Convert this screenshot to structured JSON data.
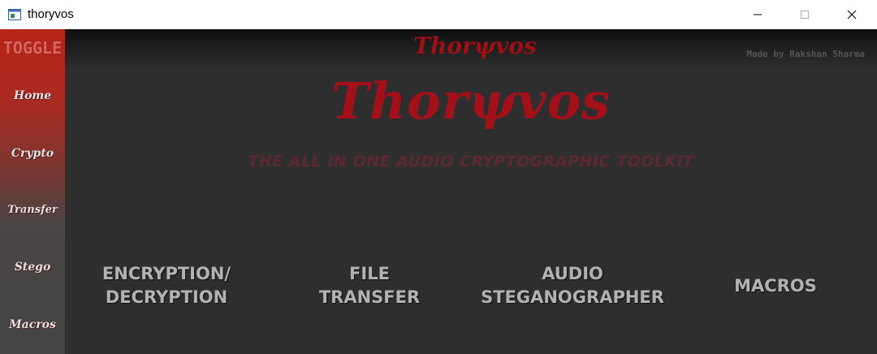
{
  "window": {
    "title": "thoryvos"
  },
  "sidebar": {
    "toggle_label": "TOGGLE",
    "items": [
      {
        "label": "Home"
      },
      {
        "label": "Crypto"
      },
      {
        "label": "Transfer"
      },
      {
        "label": "Stego"
      },
      {
        "label": "Macros"
      }
    ]
  },
  "header": {
    "logo": "Thorψvos",
    "credit": "Made by Rakshan Sharma"
  },
  "hero": {
    "title": "Thorψvos",
    "subtitle": "THE ALL IN ONE AUDIO CRYPTOGRAPHIC TOOLKIT"
  },
  "tools": [
    {
      "label": "ENCRYPTION/\nDECRYPTION"
    },
    {
      "label": "FILE\nTRANSFER"
    },
    {
      "label": "AUDIO\nSTEGANOGRAPHER"
    },
    {
      "label": "MACROS"
    }
  ],
  "colors": {
    "accent": "#a3101a",
    "sidebar_top": "#b72418",
    "sidebar_bottom": "#444444",
    "background": "#2e2e2e",
    "tool_text": "#b2b2b2"
  }
}
